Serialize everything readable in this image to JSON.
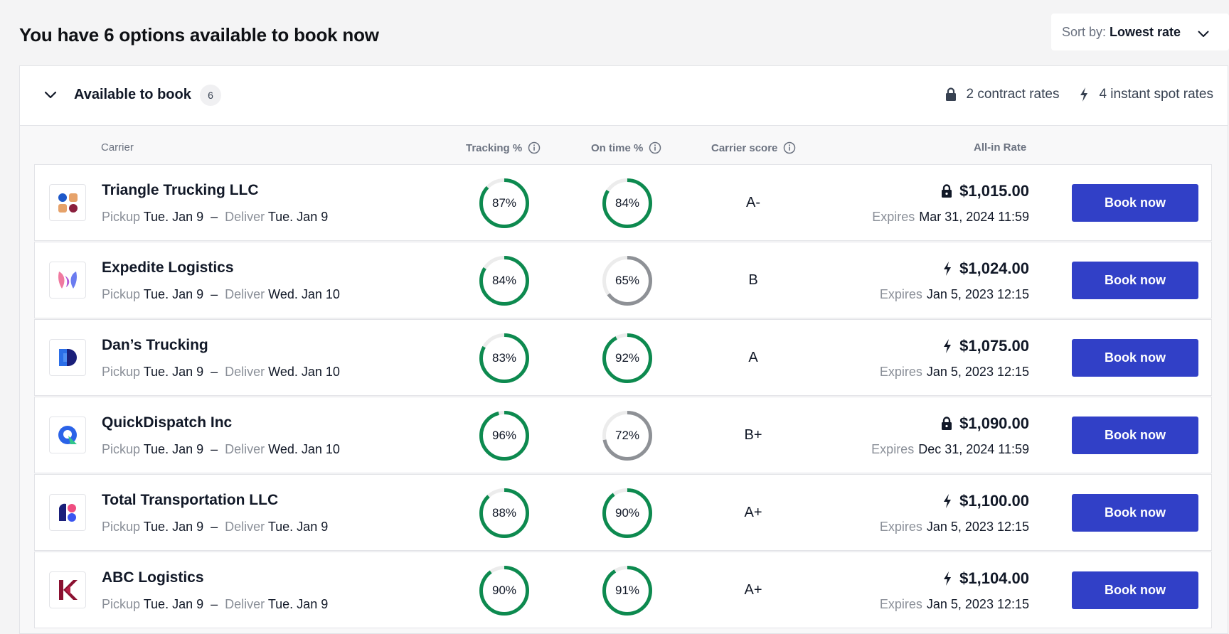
{
  "page_title": "You have 6 options available to book now",
  "sort": {
    "label": "Sort by:",
    "value": "Lowest rate"
  },
  "section": {
    "title": "Available to book",
    "count": "6",
    "contract_rates": "2 contract rates",
    "spot_rates": "4 instant spot rates"
  },
  "columns": {
    "carrier": "Carrier",
    "tracking": "Tracking %",
    "on_time": "On time %",
    "score": "Carrier score",
    "rate": "All-in Rate"
  },
  "labels": {
    "pickup": "Pickup",
    "deliver": "Deliver",
    "expires": "Expires",
    "dash": "–",
    "book": "Book now"
  },
  "colors": {
    "accent": "#3140c7",
    "ring_good": "#0d8a4f",
    "ring_neutral": "#8e9196",
    "track_bg": "#ececec"
  },
  "rows": [
    {
      "carrier": "Triangle Trucking LLC",
      "pickup": "Tue. Jan 9",
      "deliver": "Tue. Jan 9",
      "tracking": "87%",
      "tracking_value": 87,
      "on_time": "84%",
      "on_time_value": 84,
      "on_time_status": "good",
      "score": "A-",
      "rate_type": "lock-icon",
      "rate": "$1,015.00",
      "expires": "Mar 31, 2024 11:59"
    },
    {
      "carrier": "Expedite Logistics",
      "pickup": "Tue. Jan 9",
      "deliver": "Wed. Jan 10",
      "tracking": "84%",
      "tracking_value": 84,
      "on_time": "65%",
      "on_time_value": 65,
      "on_time_status": "neutral",
      "score": "B",
      "rate_type": "bolt-icon",
      "rate": "$1,024.00",
      "expires": "Jan 5, 2023 12:15"
    },
    {
      "carrier": "Dan’s Trucking",
      "pickup": "Tue. Jan 9",
      "deliver": "Wed. Jan 10",
      "tracking": "83%",
      "tracking_value": 83,
      "on_time": "92%",
      "on_time_value": 92,
      "on_time_status": "good",
      "score": "A",
      "rate_type": "bolt-icon",
      "rate": "$1,075.00",
      "expires": "Jan 5, 2023 12:15"
    },
    {
      "carrier": "QuickDispatch Inc",
      "pickup": "Tue. Jan 9",
      "deliver": "Wed. Jan 10",
      "tracking": "96%",
      "tracking_value": 96,
      "on_time": "72%",
      "on_time_value": 72,
      "on_time_status": "neutral",
      "score": "B+",
      "rate_type": "lock-icon",
      "rate": "$1,090.00",
      "expires": "Dec 31, 2024 11:59"
    },
    {
      "carrier": "Total Transportation LLC",
      "pickup": "Tue. Jan 9",
      "deliver": "Tue. Jan 9",
      "tracking": "88%",
      "tracking_value": 88,
      "on_time": "90%",
      "on_time_value": 90,
      "on_time_status": "good",
      "score": "A+",
      "rate_type": "bolt-icon",
      "rate": "$1,100.00",
      "expires": "Jan 5, 2023 12:15"
    },
    {
      "carrier": "ABC Logistics",
      "pickup": "Tue. Jan 9",
      "deliver": "Tue. Jan 9",
      "tracking": "90%",
      "tracking_value": 90,
      "on_time": "91%",
      "on_time_value": 91,
      "on_time_status": "good",
      "score": "A+",
      "rate_type": "bolt-icon",
      "rate": "$1,104.00",
      "expires": "Jan 5, 2023 12:15"
    }
  ]
}
